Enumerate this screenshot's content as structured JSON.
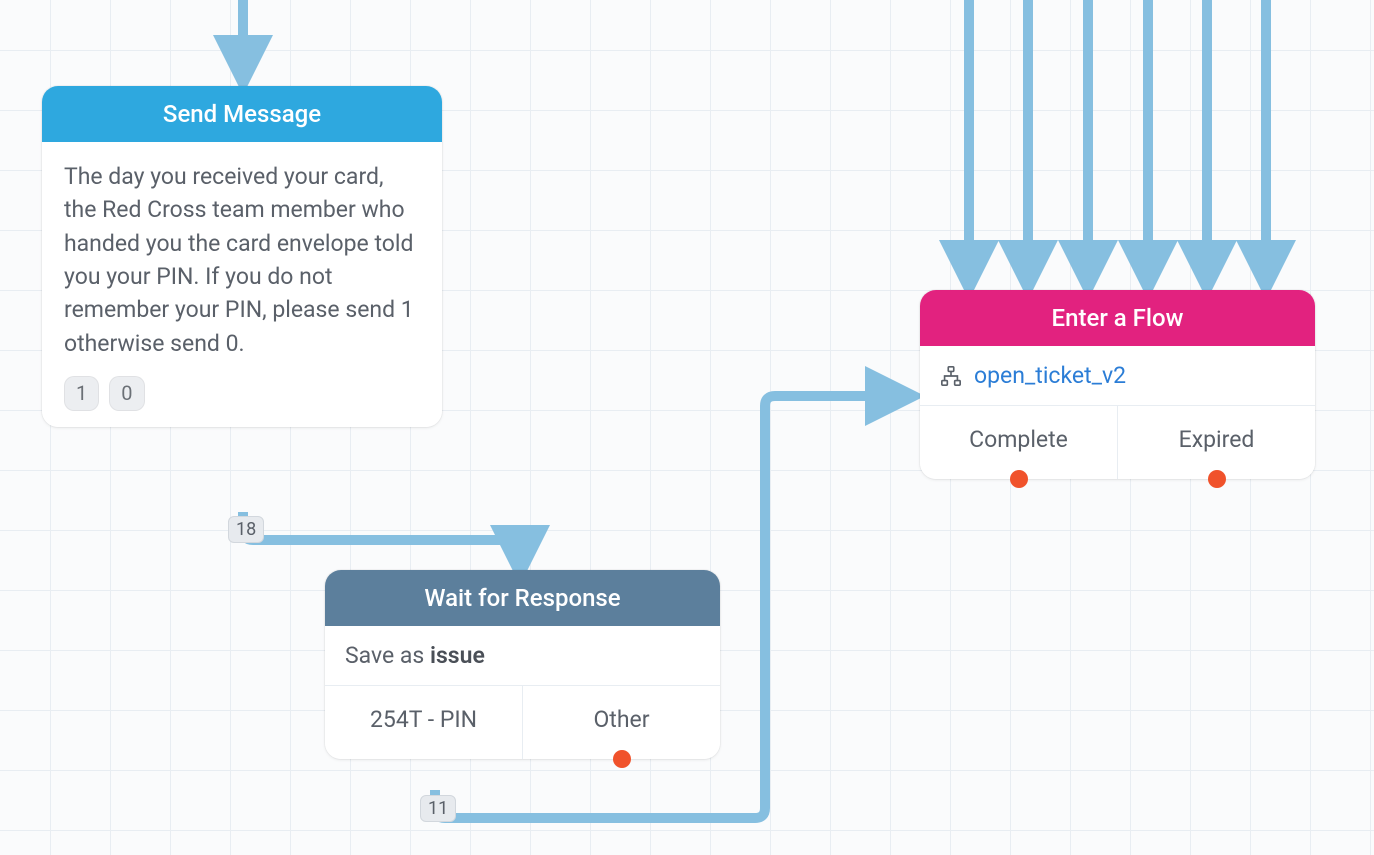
{
  "colors": {
    "header_blue": "#2ea8df",
    "header_slate": "#5c7f9c",
    "header_pink": "#e2227f",
    "arrow": "#86bfe0",
    "dot": "#f0522b",
    "link": "#2b7dd6"
  },
  "sendMessage": {
    "title": "Send Message",
    "body": "The day you received your card, the Red Cross team member who handed you the card envelope told you your PIN. If you do not remember your PIN, please send 1 otherwise send 0.",
    "replies": [
      "1",
      "0"
    ],
    "exit_count": "18"
  },
  "waitResponse": {
    "title": "Wait for Response",
    "save_as_prefix": "Save as ",
    "save_as_var": "issue",
    "outcomes": [
      {
        "label": "254T - PIN",
        "has_dot": false
      },
      {
        "label": "Other",
        "has_dot": true
      }
    ],
    "exit_count": "11"
  },
  "enterFlow": {
    "title": "Enter a Flow",
    "flow_name": "open_ticket_v2",
    "outcomes": [
      {
        "label": "Complete",
        "has_dot": true
      },
      {
        "label": "Expired",
        "has_dot": true
      }
    ]
  },
  "incoming_arrows_to_flow": 6
}
